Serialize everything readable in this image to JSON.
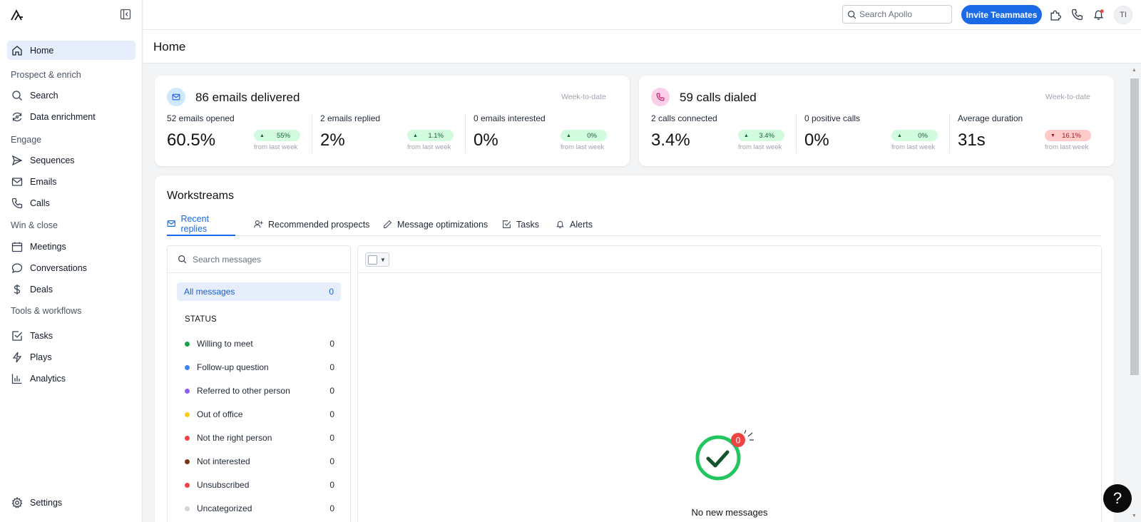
{
  "sidebar": {
    "items": [
      {
        "label": "Home"
      },
      {
        "label": "Search"
      },
      {
        "label": "Data enrichment"
      },
      {
        "label": "Sequences"
      },
      {
        "label": "Emails"
      },
      {
        "label": "Calls"
      },
      {
        "label": "Meetings"
      },
      {
        "label": "Conversations"
      },
      {
        "label": "Deals"
      },
      {
        "label": "Tasks"
      },
      {
        "label": "Plays"
      },
      {
        "label": "Analytics"
      },
      {
        "label": "Settings"
      }
    ],
    "sections": [
      "Prospect & enrich",
      "Engage",
      "Win & close",
      "Tools & workflows"
    ]
  },
  "topbar": {
    "search_placeholder": "Search Apollo",
    "invite_label": "Invite Teammates",
    "avatar_initials": "TI"
  },
  "page": {
    "title": "Home"
  },
  "email_card": {
    "title": "86 emails delivered",
    "period": "Week-to-date",
    "metrics": [
      {
        "label": "52 emails opened",
        "value": "60.5%",
        "change": "55%",
        "dir": "up",
        "from": "from last week"
      },
      {
        "label": "2 emails replied",
        "value": "2%",
        "change": "1.1%",
        "dir": "up",
        "from": "from last week"
      },
      {
        "label": "0 emails interested",
        "value": "0%",
        "change": "0%",
        "dir": "up",
        "from": "from last week"
      }
    ]
  },
  "calls_card": {
    "title": "59 calls dialed",
    "period": "Week-to-date",
    "metrics": [
      {
        "label": "2 calls connected",
        "value": "3.4%",
        "change": "3.4%",
        "dir": "up",
        "from": "from last week"
      },
      {
        "label": "0 positive calls",
        "value": "0%",
        "change": "0%",
        "dir": "up",
        "from": "from last week"
      },
      {
        "label": "Average duration",
        "value": "31s",
        "change": "16.1%",
        "dir": "down",
        "from": "from last week"
      }
    ]
  },
  "workstreams": {
    "title": "Workstreams",
    "tabs": [
      {
        "label": "Recent replies"
      },
      {
        "label": "Recommended prospects"
      },
      {
        "label": "Message optimizations"
      },
      {
        "label": "Tasks"
      },
      {
        "label": "Alerts"
      }
    ],
    "search_placeholder": "Search messages",
    "all_messages": {
      "label": "All messages",
      "count": "0"
    },
    "status_heading": "STATUS",
    "statuses": [
      {
        "label": "Willing to meet",
        "count": "0",
        "color": "#16a34a"
      },
      {
        "label": "Follow-up question",
        "count": "0",
        "color": "#3b82f6"
      },
      {
        "label": "Referred to other person",
        "count": "0",
        "color": "#8b5cf6"
      },
      {
        "label": "Out of office",
        "count": "0",
        "color": "#facc15"
      },
      {
        "label": "Not the right person",
        "count": "0",
        "color": "#ef4444"
      },
      {
        "label": "Not interested",
        "count": "0",
        "color": "#78350f"
      },
      {
        "label": "Unsubscribed",
        "count": "0",
        "color": "#ef4444"
      },
      {
        "label": "Uncategorized",
        "count": "0",
        "color": "#d1d5db"
      }
    ],
    "empty_badge": "0",
    "empty_text": "No new messages"
  },
  "help": {
    "label": "?"
  },
  "colors": {
    "accent": "#1a6ae8",
    "positive": "#d1fadf",
    "negative": "#fecaca"
  }
}
